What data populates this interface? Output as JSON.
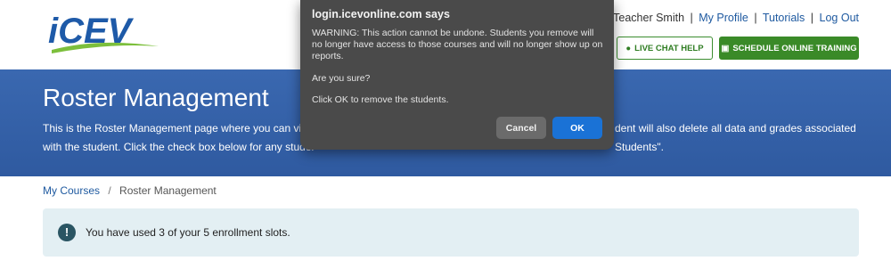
{
  "header": {
    "logo_text": "iCEV",
    "user_name": "Teacher Smith",
    "links": [
      "My Profile",
      "Tutorials",
      "Log Out"
    ],
    "live_chat_label": "LIVE CHAT HELP",
    "schedule_label": "SCHEDULE ONLINE TRAINING"
  },
  "banner": {
    "title": "Roster Management",
    "desc_line1_left": "This is the Roster Management page where you can view",
    "desc_line1_right": "dent will also delete all data and grades associated",
    "desc_line2_left": "with the student. Click the check box below for any studer",
    "desc_line2_right": "Students\"."
  },
  "breadcrumb": {
    "root": "My Courses",
    "separator": "/",
    "current": "Roster Management"
  },
  "alert": {
    "icon": "!",
    "text": "You have used 3 of your 5 enrollment slots."
  },
  "dialog": {
    "title": "login.icevonline.com says",
    "message": "WARNING: This action cannot be undone. Students you remove will no longer have access to those courses and will no longer show up on reports.",
    "question": "Are you sure?",
    "instruction": "Click OK to remove the students.",
    "cancel_label": "Cancel",
    "ok_label": "OK"
  },
  "colors": {
    "banner_blue": "#3a68b0",
    "brand_green": "#3a8a28",
    "link_blue": "#1f5aa0",
    "ok_blue": "#1a72d6"
  }
}
